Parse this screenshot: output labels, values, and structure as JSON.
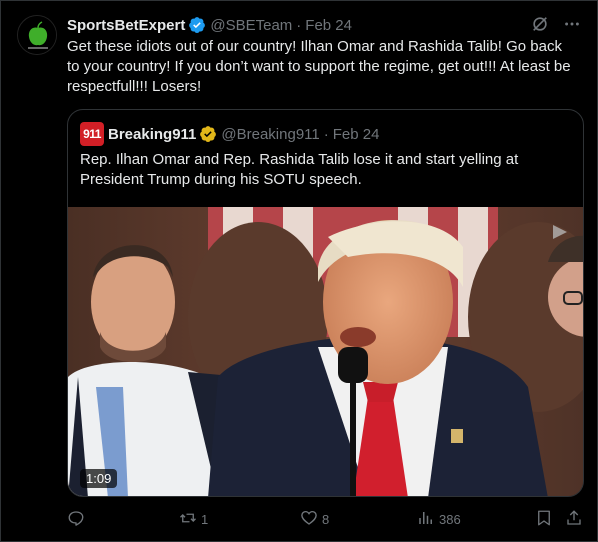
{
  "author": {
    "name": "SportsBetExpert",
    "handle": "@SBETeam",
    "separator": "·",
    "date": "Feb 24"
  },
  "tweet_text": "Get these idiots out of our country! Ilhan Omar and Rashida Talib! Go back to your country! If you don’t want to support the regime, get out!!! At least be respectfull!!! Losers!",
  "quoted": {
    "avatar_text": "911",
    "name": "Breaking911",
    "handle": "@Breaking911",
    "separator": "·",
    "date": "Feb 24",
    "text": "Rep. Ilhan Omar and Rep. Rashida Talib lose it and start yelling at President Trump during his SOTU speech.",
    "video_duration": "1:09"
  },
  "actions": {
    "replies": "",
    "reposts": "1",
    "likes": "8",
    "views": "386"
  },
  "colors": {
    "background": "#000000",
    "text": "#e7e9ea",
    "muted": "#71767b",
    "border": "#2f3336",
    "verified_blue": "#1d9bf0",
    "verified_gold": "#e2b719",
    "breaking_red": "#d21f26"
  },
  "icons": [
    "verified-icon",
    "grok-icon",
    "more-icon",
    "reply-icon",
    "repost-icon",
    "like-icon",
    "views-icon",
    "bookmark-icon",
    "share-icon",
    "gif-indicator-icon"
  ]
}
